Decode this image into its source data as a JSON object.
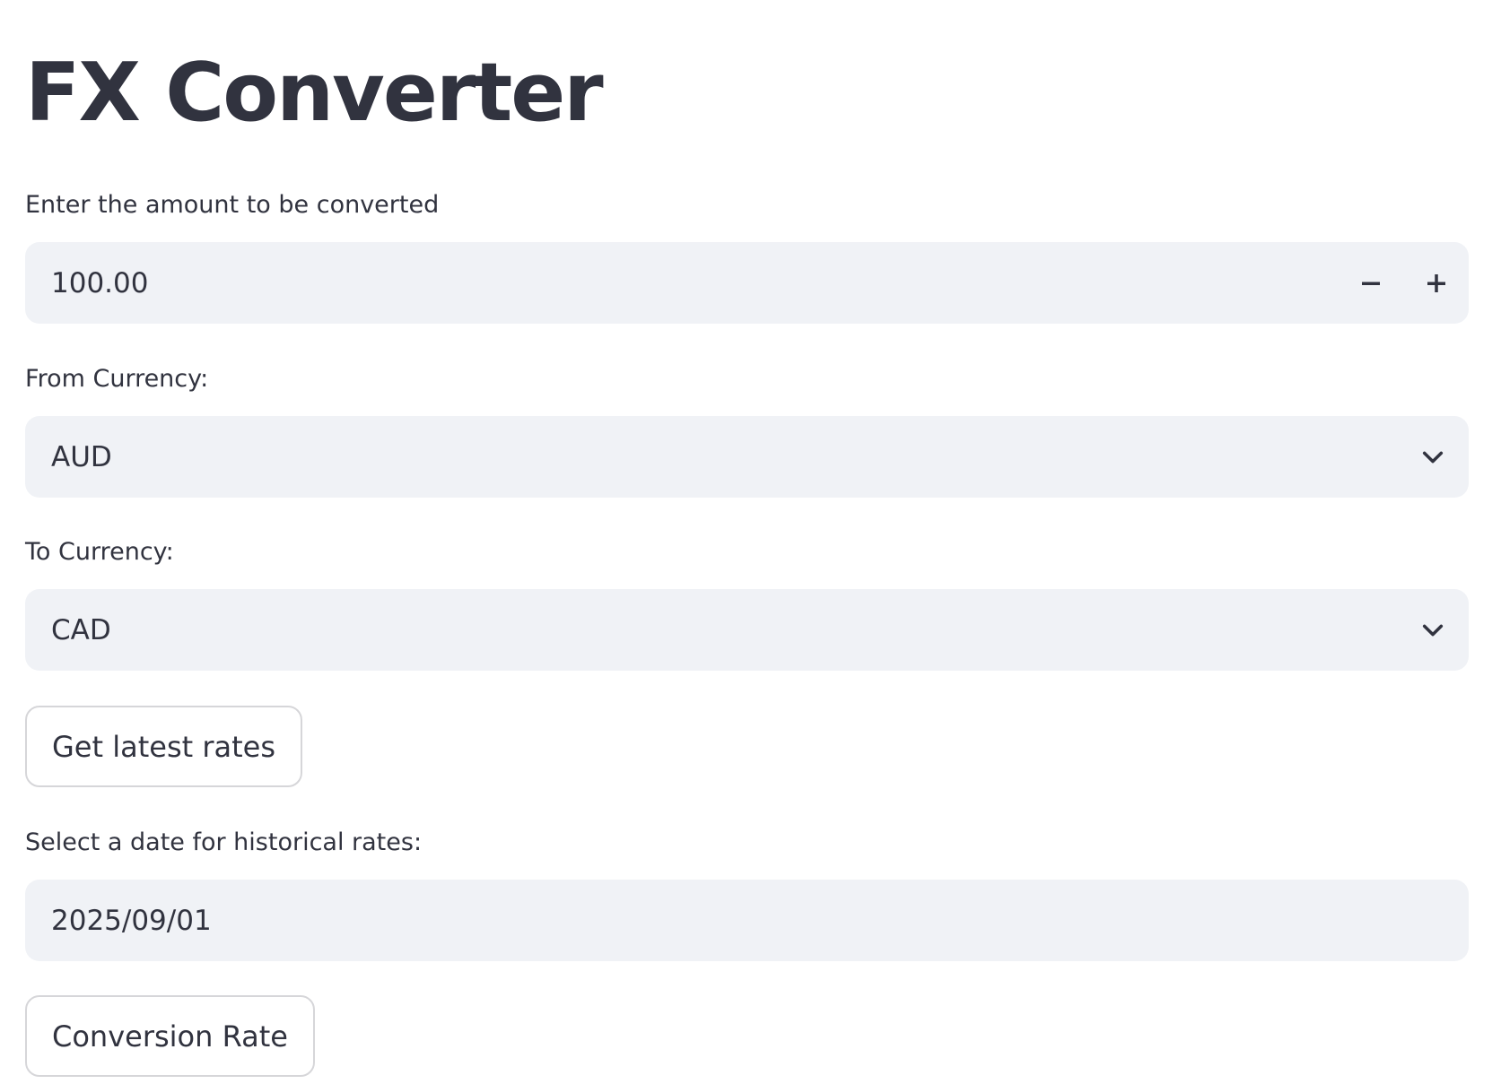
{
  "app": {
    "title": "FX Converter"
  },
  "amount": {
    "label": "Enter the amount to be converted",
    "value": "100.00",
    "decrement_icon": "minus-icon",
    "increment_icon": "plus-icon"
  },
  "from_currency": {
    "label": "From Currency:",
    "selected": "AUD",
    "icon": "chevron-down-icon"
  },
  "to_currency": {
    "label": "To Currency:",
    "selected": "CAD",
    "icon": "chevron-down-icon"
  },
  "latest_button": {
    "label": "Get latest rates"
  },
  "historical_date": {
    "label": "Select a date for historical rates:",
    "value": "2025/09/01"
  },
  "conversion_button": {
    "label": "Conversion Rate"
  }
}
